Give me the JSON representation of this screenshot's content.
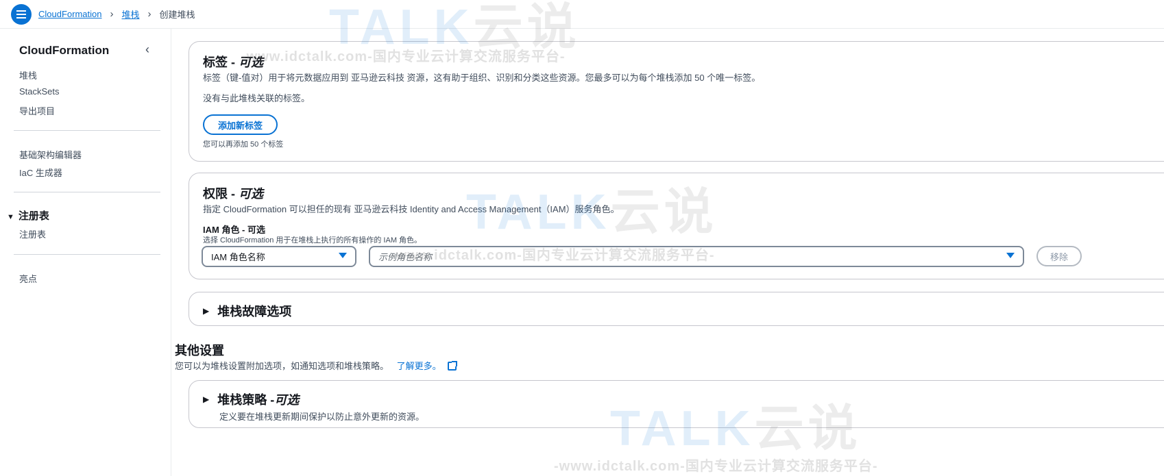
{
  "breadcrumbs": {
    "items": [
      "CloudFormation",
      "堆栈"
    ],
    "current": "创建堆栈"
  },
  "sidebar": {
    "title": "CloudFormation",
    "group1": [
      "堆栈",
      "StackSets",
      "导出项目"
    ],
    "group2": [
      "基础架构编辑器",
      "IaC 生成器"
    ],
    "section": "注册表",
    "section_items": [
      "注册表"
    ],
    "group3": [
      "亮点"
    ]
  },
  "tags": {
    "title": "标签 - ",
    "title_opt": "可选",
    "description": "标签（键-值对）用于将元数据应用到 亚马逊云科技 资源，这有助于组织、识别和分类这些资源。您最多可以为每个堆栈添加 50 个唯一标签。",
    "empty": "没有与此堆栈关联的标签。",
    "add_button": "添加新标签",
    "hint": "您可以再添加 50 个标签"
  },
  "permissions": {
    "title": "权限 - ",
    "title_opt": "可选",
    "description": "指定 CloudFormation 可以担任的现有 亚马逊云科技 Identity and Access Management（IAM）服务角色。",
    "role_label": "IAM 角色 - 可选",
    "role_hint": "选择 CloudFormation 用于在堆栈上执行的所有操作的 IAM 角色。",
    "type_select": "IAM 角色名称",
    "name_placeholder": "示例角色名称",
    "remove_button": "移除"
  },
  "stack_failure": {
    "title": "堆栈故障选项"
  },
  "other_settings": {
    "title": "其他设置",
    "description": "您可以为堆栈设置附加选项，如通知选项和堆栈策略。",
    "learn_more": "了解更多。"
  },
  "stack_policy": {
    "title": "堆栈策略 - ",
    "title_opt": "可选",
    "description": "定义要在堆栈更新期间保护以防止意外更新的资源。"
  },
  "watermark": {
    "logo": "TALK",
    "logo_cn": "云说",
    "url": "-www.idctalk.com-国内专业云计算交流服务平台-"
  },
  "colors": {
    "accent": "#0972d3",
    "text": "#16191f",
    "muted": "#414d5c",
    "border": "#c6c6cd"
  }
}
